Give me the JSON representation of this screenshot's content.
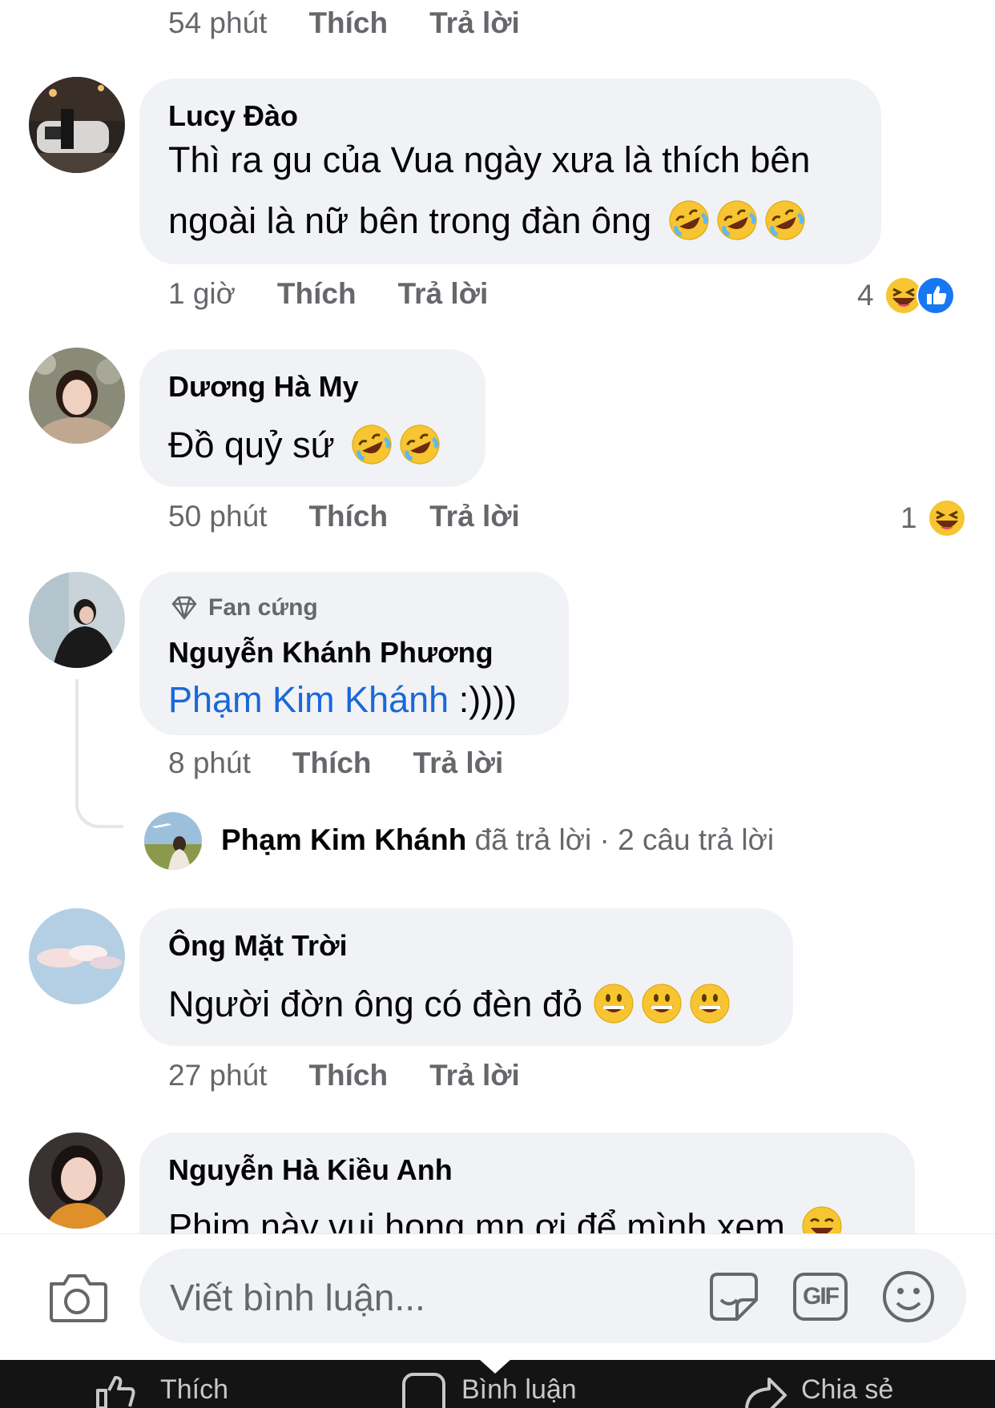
{
  "comments": [
    {
      "id": "c0",
      "time": "54 phút",
      "like": "Thích",
      "reply": "Trả lời"
    },
    {
      "id": "c1",
      "name": "Lucy Đào",
      "lines": [
        "Thì ra gu của Vua ngày xưa là thích bên",
        "ngoài là nữ bên trong đàn ông"
      ],
      "time": "1 giờ",
      "like": "Thích",
      "reply": "Trả lời",
      "reaction_count": "4"
    },
    {
      "id": "c2",
      "name": "Dương Hà My",
      "text": "Đồ quỷ sứ",
      "time": "50 phút",
      "like": "Thích",
      "reply": "Trả lời",
      "reaction_count": "1"
    },
    {
      "id": "c3",
      "badge": "Fan cứng",
      "name": "Nguyễn Khánh Phương",
      "mention": "Phạm Kim Khánh",
      "text": " :))))",
      "time": "8 phút",
      "like": "Thích",
      "reply": "Trả lời",
      "reply_summary": {
        "name": "Phạm Kim Khánh",
        "action": " đã trả lời",
        "sep": " · ",
        "count": "2 câu trả lời"
      }
    },
    {
      "id": "c4",
      "name": "Ông Mặt Trời",
      "text": "Người đờn ông có đèn đỏ",
      "time": "27 phút",
      "like": "Thích",
      "reply": "Trả lời"
    },
    {
      "id": "c5",
      "name": "Nguyễn Hà Kiều Anh",
      "text": "Phim này vui hong mn ơi để mình xem"
    }
  ],
  "composer": {
    "placeholder": "Viết bình luận...",
    "icons": [
      "camera-icon",
      "sticker-icon",
      "gif-icon",
      "emoji-icon"
    ],
    "gif_label": "GIF"
  },
  "bottom_bar": {
    "like": "Thích",
    "comment": "Bình luận",
    "share": "Chia sẻ"
  },
  "colors": {
    "bubble": "#f0f2f5",
    "meta": "#65676b",
    "mention": "#1a68d8",
    "like_blue": "#1877f2",
    "bottom_bar": "#141414"
  }
}
